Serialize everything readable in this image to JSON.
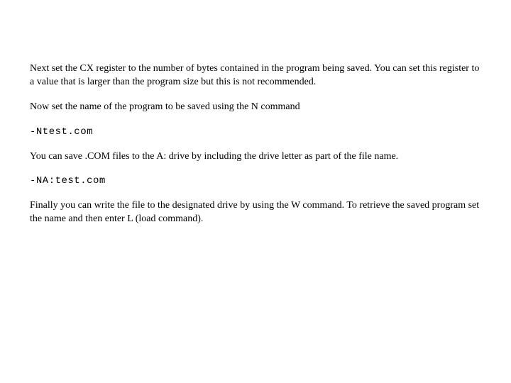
{
  "paragraphs": {
    "p1": "Next set the CX register to the number of bytes contained in the program being saved.  You can set this register to a value that is larger than the program size but this is not recommended.",
    "p2": "Now set the name of the program to be saved using the N command",
    "p3": "-Ntest.com",
    "p4": "You can save .COM files to the A: drive by including the drive letter as part of the file name.",
    "p5": "-NA:test.com",
    "p6": "Finally you can write the file to the designated drive by using the W command.  To retrieve the saved program set the name and then enter L (load command)."
  }
}
